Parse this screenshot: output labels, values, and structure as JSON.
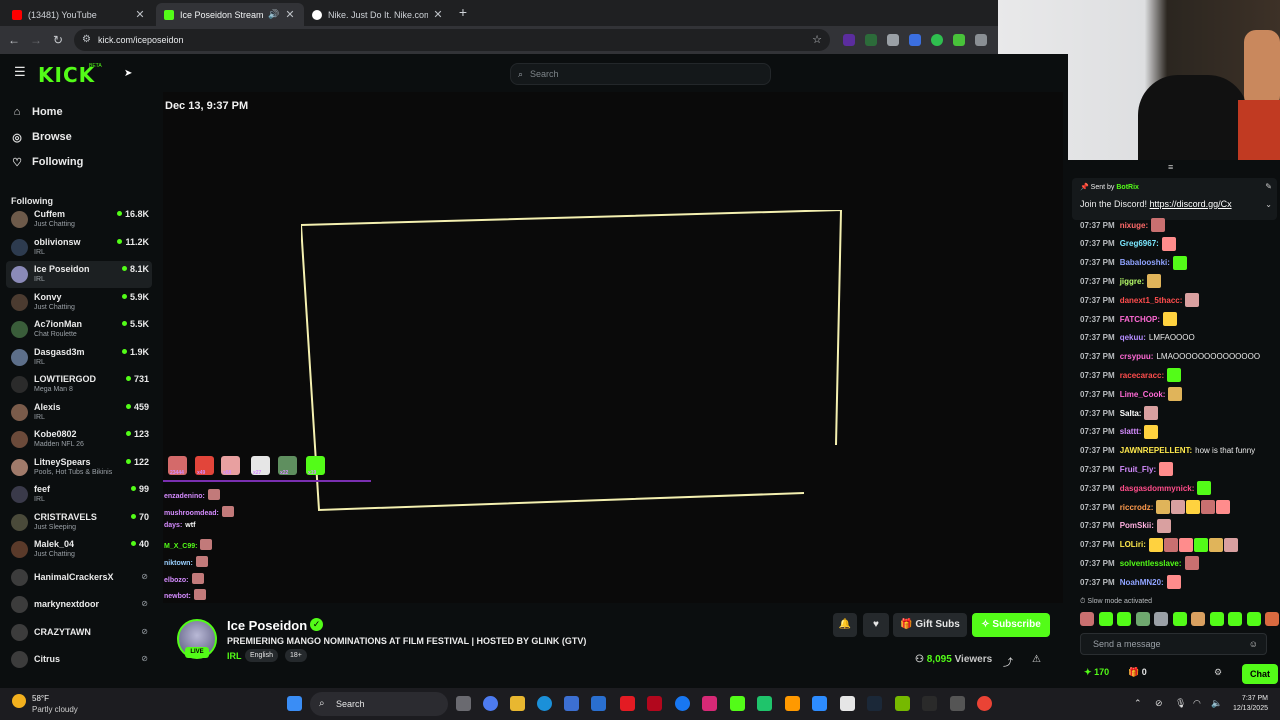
{
  "browser": {
    "tabs": [
      {
        "label": "(13481) YouTube",
        "favicon_color": "#ff0000",
        "active": false
      },
      {
        "label": "Ice Poseidon Stream - Watch...",
        "favicon_color": "#53fc18",
        "active": true
      },
      {
        "label": "Nike. Just Do It. Nike.com",
        "favicon_color": "#ffffff",
        "active": false
      }
    ],
    "url": "kick.com/iceposeidon"
  },
  "kick": {
    "logo": "KICK",
    "logo_badge": "BETA",
    "search_placeholder": "Search",
    "nav": [
      {
        "icon": "home-icon",
        "label": "Home"
      },
      {
        "icon": "browse-icon",
        "label": "Browse"
      },
      {
        "icon": "heart-icon",
        "label": "Following"
      }
    ],
    "following_heading": "Following",
    "channels": [
      {
        "name": "Cuffem",
        "category": "Just Chatting",
        "viewers": "16.8K",
        "live": true,
        "avatar_color": "#6d5a4a"
      },
      {
        "name": "oblivionsw",
        "category": "IRL",
        "viewers": "11.2K",
        "live": true,
        "avatar_color": "#2d3b4f"
      },
      {
        "name": "Ice Poseidon",
        "category": "IRL",
        "viewers": "8.1K",
        "live": true,
        "avatar_color": "#8a8ab8"
      },
      {
        "name": "Konvy",
        "category": "Just Chatting",
        "viewers": "5.9K",
        "live": true,
        "avatar_color": "#4b3b30"
      },
      {
        "name": "Ac7ionMan",
        "category": "Chat Roulette",
        "viewers": "5.5K",
        "live": true,
        "avatar_color": "#3a5d3a"
      },
      {
        "name": "Dasgasd3m",
        "category": "IRL",
        "viewers": "1.9K",
        "live": true,
        "avatar_color": "#5d6f8a"
      },
      {
        "name": "LOWTIERGOD",
        "category": "Mega Man 8",
        "viewers": "731",
        "live": true,
        "avatar_color": "#2b2b2b"
      },
      {
        "name": "Alexis",
        "category": "IRL",
        "viewers": "459",
        "live": true,
        "avatar_color": "#7a5b4a"
      },
      {
        "name": "Kobe0802",
        "category": "Madden NFL 26",
        "viewers": "123",
        "live": true,
        "avatar_color": "#6b4a3a"
      },
      {
        "name": "LitneySpears",
        "category": "Pools, Hot Tubs & Bikinis",
        "viewers": "122",
        "live": true,
        "avatar_color": "#a07a6a"
      },
      {
        "name": "feef",
        "category": "IRL",
        "viewers": "99",
        "live": true,
        "avatar_color": "#3a3a4a"
      },
      {
        "name": "CRISTRAVELS",
        "category": "Just Sleeping",
        "viewers": "70",
        "live": true,
        "avatar_color": "#4a4a3a"
      },
      {
        "name": "Malek_04",
        "category": "Just Chatting",
        "viewers": "40",
        "live": true,
        "avatar_color": "#5a3a2a"
      },
      {
        "name": "HanimalCrackersX",
        "category": "",
        "viewers": "",
        "live": false,
        "avatar_color": "#3c3c3c"
      },
      {
        "name": "markynextdoor",
        "category": "",
        "viewers": "",
        "live": false,
        "avatar_color": "#3c3c3c"
      },
      {
        "name": "CRAZYTAWN",
        "category": "",
        "viewers": "",
        "live": false,
        "avatar_color": "#3c3c3c"
      },
      {
        "name": "Citrus",
        "category": "",
        "viewers": "",
        "live": false,
        "avatar_color": "#3c3c3c"
      }
    ],
    "video": {
      "date": "Dec 13, 9:37 PM",
      "overlay_counts": [
        "23444",
        "x49",
        "x68",
        "x27",
        "x22",
        "x19"
      ],
      "overlay_chat": [
        {
          "user": "enzadenino:",
          "color": "#d58cff"
        },
        {
          "user": "mushroomdead:",
          "color": "#d58cff"
        },
        {
          "user": "days:",
          "text": "wtf",
          "color": "#d58cff"
        },
        {
          "user": "M_X_C99:",
          "color": "#53fc18"
        },
        {
          "user": "niktown:",
          "color": "#9ad0ff"
        },
        {
          "user": "elbozo:",
          "color": "#d58cff"
        },
        {
          "user": "newbot:",
          "color": "#d58cff"
        }
      ]
    },
    "stream": {
      "name": "Ice Poseidon",
      "live_badge": "LIVE",
      "title": "PREMIERING MANGO NOMINATIONS AT FILM FESTIVAL | HOSTED BY GLINK (GTV)",
      "category": "IRL",
      "tags": [
        "English",
        "18+"
      ],
      "gift_subs_label": "Gift Subs",
      "subscribe_label": "Subscribe",
      "viewers": "8,095",
      "viewers_label": "Viewers"
    },
    "chat": {
      "pinned": {
        "sent_by_label": "Sent by",
        "sender": "BotRix",
        "message": "Join the Discord!",
        "link": "https://discord.gg/Cx"
      },
      "messages": [
        {
          "time": "07:37 PM",
          "user": "nixuge:",
          "color": "#ff6a6a",
          "text": "",
          "emotes": 1
        },
        {
          "time": "07:37 PM",
          "user": "Greg6967:",
          "color": "#7ce8ff",
          "text": "",
          "emotes": 1
        },
        {
          "time": "07:37 PM",
          "user": "Babalooshki:",
          "color": "#8fa3ff",
          "text": "",
          "emotes": 1
        },
        {
          "time": "07:37 PM",
          "user": "jiggre:",
          "color": "#b8ff6a",
          "text": "",
          "emotes": 1
        },
        {
          "time": "07:37 PM",
          "user": "danext1_5thacc:",
          "color": "#ff4d4d",
          "text": "",
          "emotes": 1
        },
        {
          "time": "07:37 PM",
          "user": "FATCHOP:",
          "color": "#ff6ad5",
          "text": "",
          "emotes": 1
        },
        {
          "time": "07:37 PM",
          "user": "qekuu:",
          "color": "#b48cff",
          "text": "LMFAOOOO",
          "emotes": 0
        },
        {
          "time": "07:37 PM",
          "user": "crsypuu:",
          "color": "#ff6ad5",
          "text": "LMAOOOOOOOOOOOOOO",
          "emotes": 0
        },
        {
          "time": "07:37 PM",
          "user": "racecaracc:",
          "color": "#ff4d4d",
          "text": "",
          "emotes": 1
        },
        {
          "time": "07:37 PM",
          "user": "Lime_Cook:",
          "color": "#ff6ad5",
          "text": "",
          "emotes": 1
        },
        {
          "time": "07:37 PM",
          "user": "Salta:",
          "color": "#ffffff",
          "text": "",
          "emotes": 1
        },
        {
          "time": "07:37 PM",
          "user": "slattt:",
          "color": "#d58cff",
          "text": "",
          "emotes": 1
        },
        {
          "time": "07:37 PM",
          "user": "JAWNREPELLENT:",
          "color": "#ffe94d",
          "text": "how is that funny",
          "emotes": 0
        },
        {
          "time": "07:37 PM",
          "user": "Fruit_Fly:",
          "color": "#d58cff",
          "text": "",
          "emotes": 1
        },
        {
          "time": "07:37 PM",
          "user": "dasgasdommynick:",
          "color": "#ff4d8a",
          "text": "",
          "emotes": 1
        },
        {
          "time": "07:37 PM",
          "user": "riccrodz:",
          "color": "#ff9b4d",
          "text": "",
          "emotes": 5
        },
        {
          "time": "07:37 PM",
          "user": "PomSkii:",
          "color": "#ffb0e0",
          "text": "",
          "emotes": 1
        },
        {
          "time": "07:37 PM",
          "user": "LOLiri:",
          "color": "#ffe94d",
          "text": "",
          "emotes": 6
        },
        {
          "time": "07:37 PM",
          "user": "solventlesslave:",
          "color": "#53fc18",
          "text": "",
          "emotes": 1
        },
        {
          "time": "07:37 PM",
          "user": "NoahMN20:",
          "color": "#8fa3ff",
          "text": "",
          "emotes": 1
        }
      ],
      "slow_mode": "Slow mode activated",
      "input_placeholder": "Send a message",
      "points": "170",
      "gifts": "0",
      "send_label": "Chat"
    }
  },
  "taskbar": {
    "temperature": "58°F",
    "condition": "Partly cloudy",
    "search_label": "Search",
    "time": "7:37 PM",
    "date": "12/13/2025"
  }
}
